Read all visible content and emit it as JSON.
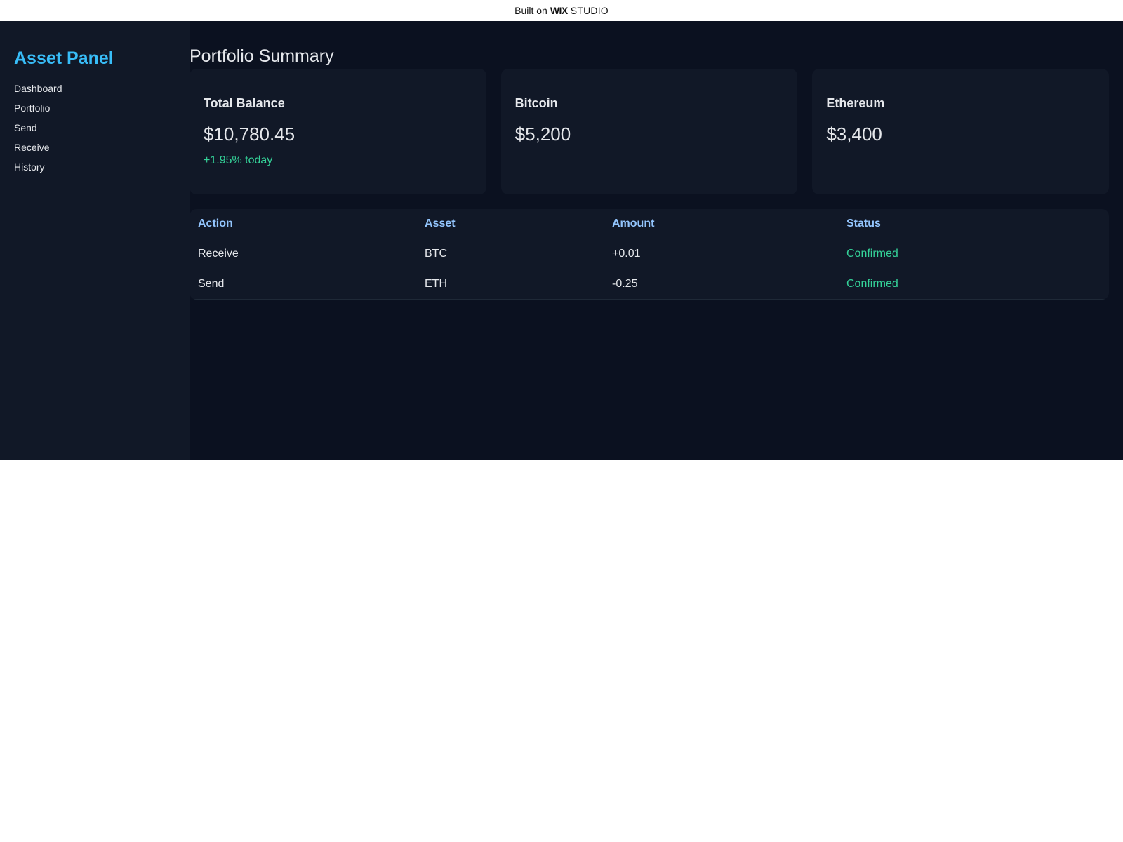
{
  "wix_bar": {
    "prefix": "Built on",
    "brand": "WIX",
    "product": "STUDIO"
  },
  "sidebar": {
    "brand": "Asset Panel",
    "items": [
      {
        "label": "Dashboard"
      },
      {
        "label": "Portfolio"
      },
      {
        "label": "Send"
      },
      {
        "label": "Receive"
      },
      {
        "label": "History"
      }
    ]
  },
  "main": {
    "title": "Portfolio Summary",
    "cards": [
      {
        "title": "Total Balance",
        "value": "$10,780.45",
        "change": "+1.95% today"
      },
      {
        "title": "Bitcoin",
        "value": "$5,200"
      },
      {
        "title": "Ethereum",
        "value": "$3,400"
      }
    ],
    "table": {
      "headers": [
        "Action",
        "Asset",
        "Amount",
        "Status"
      ],
      "rows": [
        {
          "action": "Receive",
          "asset": "BTC",
          "amount": "+0.01",
          "status": "Confirmed"
        },
        {
          "action": "Send",
          "asset": "ETH",
          "amount": "-0.25",
          "status": "Confirmed"
        }
      ]
    }
  },
  "colors": {
    "background": "#0b1120",
    "panel": "#111827",
    "brand_accent": "#38bdf8",
    "header_accent": "#93c5fd",
    "positive": "#34d399",
    "text": "#e5e7eb"
  }
}
